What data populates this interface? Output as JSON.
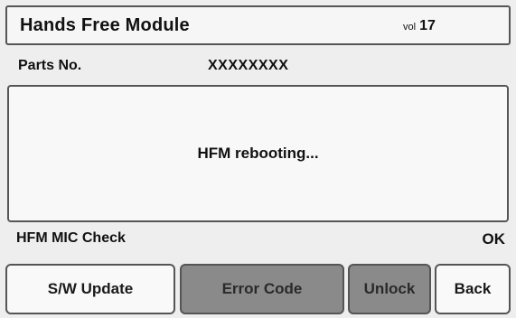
{
  "header": {
    "title": "Hands Free Module",
    "volume_label": "vol",
    "volume_value": "17"
  },
  "parts": {
    "label": "Parts No.",
    "value": "XXXXXXXX"
  },
  "message": {
    "text": "HFM rebooting..."
  },
  "mic_check": {
    "label": "HFM MIC Check",
    "status": "OK"
  },
  "buttons": {
    "sw_update": "S/W Update",
    "error_code": "Error Code",
    "unlock": "Unlock",
    "back": "Back"
  },
  "colors": {
    "active_button": "#f9f9f9",
    "disabled_button": "#8a8a8a",
    "border": "#555555"
  }
}
